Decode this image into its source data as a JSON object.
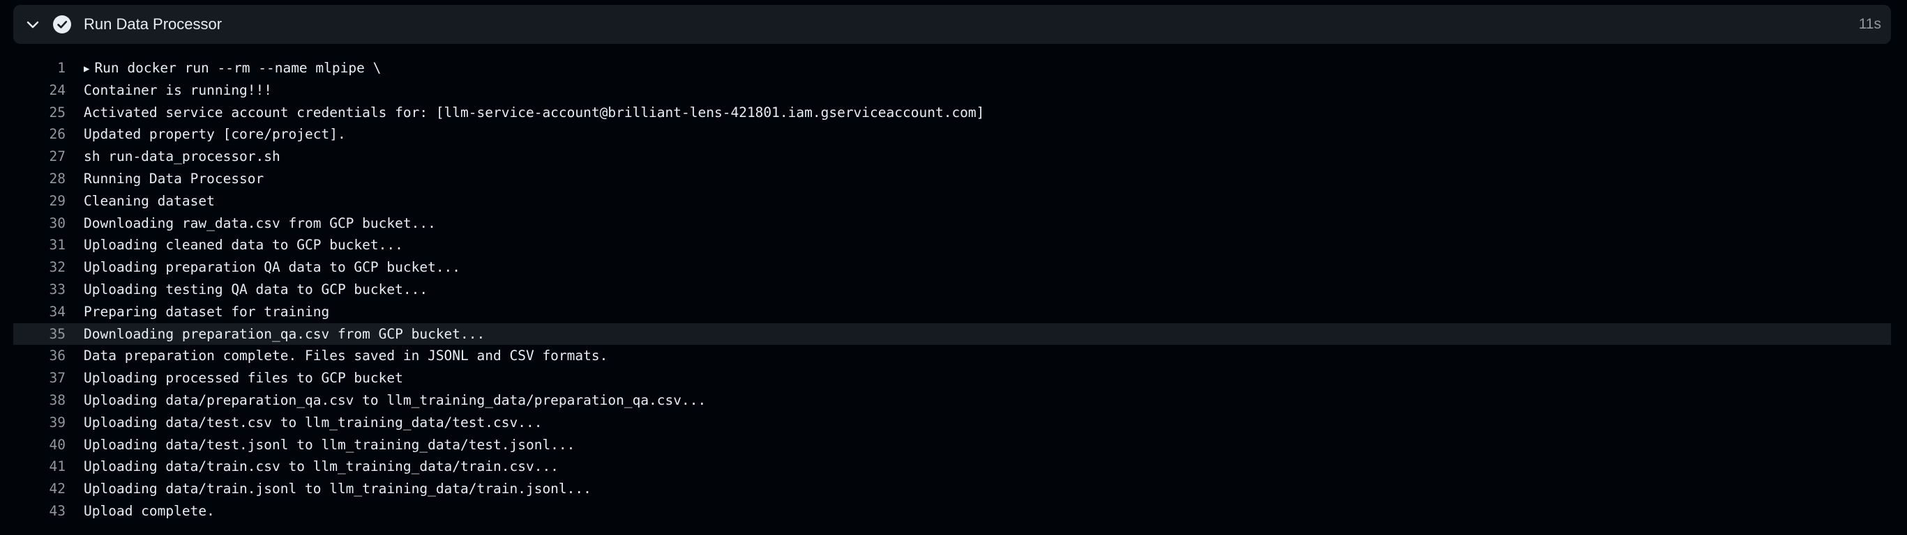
{
  "step": {
    "title": "Run Data Processor",
    "duration": "11s",
    "status": "success",
    "chevron_icon": "chevron-down-icon",
    "status_icon": "check-circle-icon"
  },
  "log": [
    {
      "number": "1",
      "text": "Run docker run --rm --name mlpipe \\",
      "collapsible": true
    },
    {
      "number": "24",
      "text": "Container is running!!!"
    },
    {
      "number": "25",
      "text": "Activated service account credentials for: [llm-service-account@brilliant-lens-421801.iam.gserviceaccount.com]"
    },
    {
      "number": "26",
      "text": "Updated property [core/project]."
    },
    {
      "number": "27",
      "text": "sh run-data_processor.sh"
    },
    {
      "number": "28",
      "text": "Running Data Processor"
    },
    {
      "number": "29",
      "text": "Cleaning dataset"
    },
    {
      "number": "30",
      "text": "Downloading raw_data.csv from GCP bucket..."
    },
    {
      "number": "31",
      "text": "Uploading cleaned data to GCP bucket..."
    },
    {
      "number": "32",
      "text": "Uploading preparation QA data to GCP bucket..."
    },
    {
      "number": "33",
      "text": "Uploading testing QA data to GCP bucket..."
    },
    {
      "number": "34",
      "text": "Preparing dataset for training"
    },
    {
      "number": "35",
      "text": "Downloading preparation_qa.csv from GCP bucket...",
      "highlighted": true
    },
    {
      "number": "36",
      "text": "Data preparation complete. Files saved in JSONL and CSV formats."
    },
    {
      "number": "37",
      "text": "Uploading processed files to GCP bucket"
    },
    {
      "number": "38",
      "text": "Uploading data/preparation_qa.csv to llm_training_data/preparation_qa.csv..."
    },
    {
      "number": "39",
      "text": "Uploading data/test.csv to llm_training_data/test.csv..."
    },
    {
      "number": "40",
      "text": "Uploading data/test.jsonl to llm_training_data/test.jsonl..."
    },
    {
      "number": "41",
      "text": "Uploading data/train.csv to llm_training_data/train.csv..."
    },
    {
      "number": "42",
      "text": "Uploading data/train.jsonl to llm_training_data/train.jsonl..."
    },
    {
      "number": "43",
      "text": "Upload complete."
    }
  ],
  "colors": {
    "background": "#010409",
    "header_bg": "#161b22",
    "text": "#e6edf3",
    "muted": "#9198a1",
    "highlight_bg": "#161b22"
  }
}
